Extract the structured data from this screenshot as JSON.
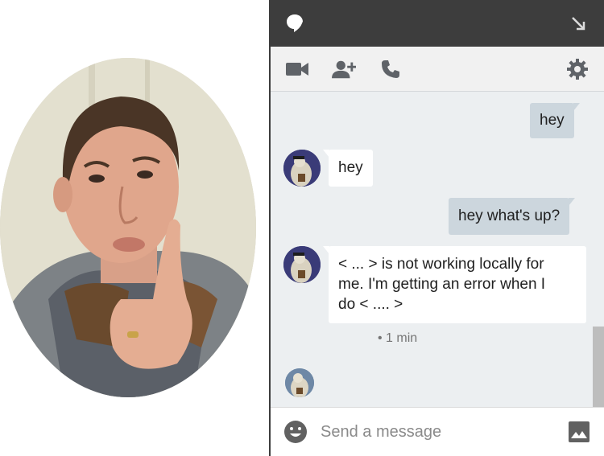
{
  "colors": {
    "titlebar": "#3d3d3d",
    "toolbar": "#f1f1f1",
    "chat_background": "#eceff1",
    "outgoing_bubble": "#ccd6dd",
    "incoming_bubble": "#ffffff",
    "icon_gray": "#5f6368"
  },
  "titlebar": {
    "icons": [
      "speech-bubble-icon",
      "minimize-arrow-icon"
    ]
  },
  "toolbar": {
    "icons": [
      "video-call-icon",
      "add-person-icon",
      "phone-icon",
      "gear-icon"
    ]
  },
  "messages": [
    {
      "direction": "out",
      "text": "hey"
    },
    {
      "direction": "in",
      "text": "hey",
      "avatar": "avatar-icon"
    },
    {
      "direction": "out",
      "text": "hey what's up?"
    },
    {
      "direction": "in",
      "lines": [
        "< ... > is not working locally for",
        "me. I'm getting an error when I",
        "do < .... >"
      ],
      "avatar": "avatar-icon"
    }
  ],
  "timestamp": "• 1 min",
  "composer": {
    "placeholder": "Send a message",
    "icons": [
      "emoji-icon",
      "image-icon"
    ]
  }
}
